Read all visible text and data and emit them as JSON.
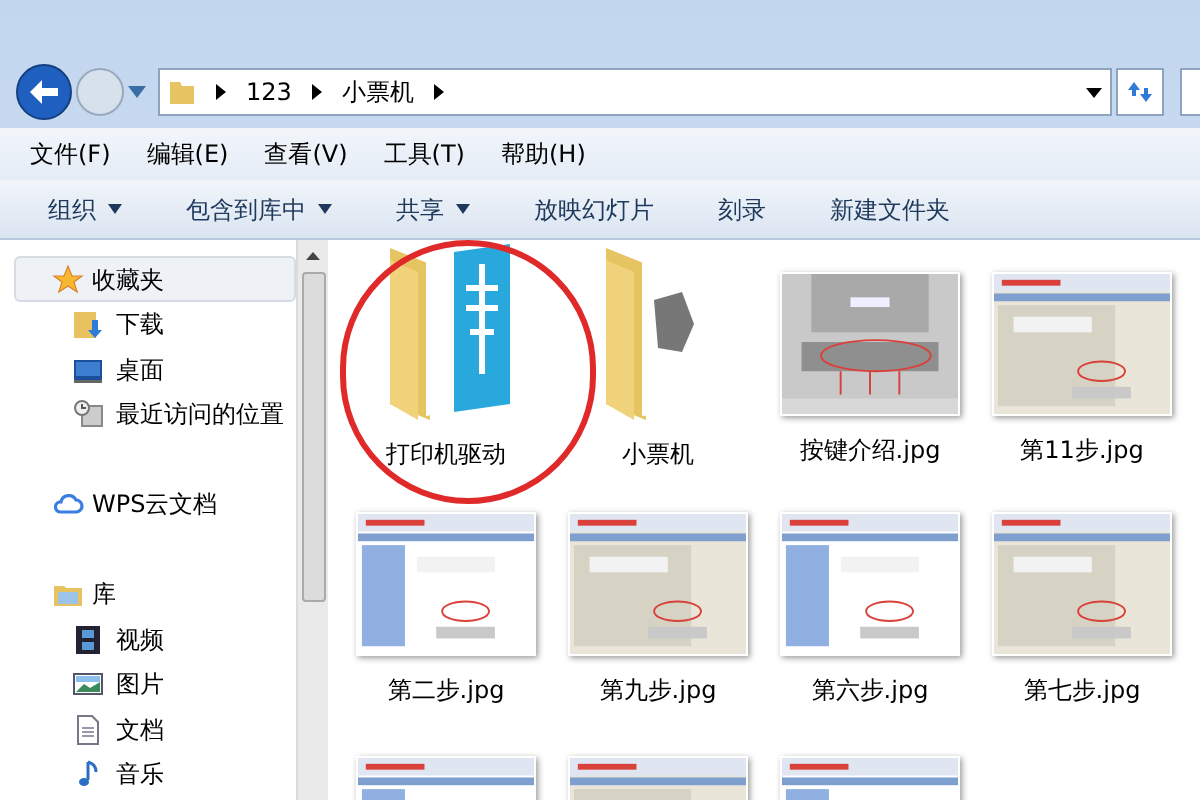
{
  "address_bar": {
    "path": [
      "123",
      "小票机"
    ]
  },
  "menu": [
    "文件(F)",
    "编辑(E)",
    "查看(V)",
    "工具(T)",
    "帮助(H)"
  ],
  "toolbar": [
    {
      "label": "组织",
      "dropdown": true
    },
    {
      "label": "包含到库中",
      "dropdown": true
    },
    {
      "label": "共享",
      "dropdown": true
    },
    {
      "label": "放映幻灯片",
      "dropdown": false
    },
    {
      "label": "刻录",
      "dropdown": false
    },
    {
      "label": "新建文件夹",
      "dropdown": false
    }
  ],
  "sidebar": {
    "sections": [
      {
        "label": "收藏夹",
        "selected": true,
        "children": [
          {
            "label": "下载"
          },
          {
            "label": "桌面"
          },
          {
            "label": "最近访问的位置"
          }
        ]
      },
      {
        "label": "WPS云文档",
        "selected": false
      },
      {
        "label": "库",
        "selected": false,
        "children": [
          {
            "label": "视频"
          },
          {
            "label": "图片"
          },
          {
            "label": "文档"
          },
          {
            "label": "音乐"
          }
        ]
      }
    ]
  },
  "files": [
    {
      "name": "打印机驱动",
      "kind": "folder",
      "circled": true
    },
    {
      "name": "小票机",
      "kind": "folder",
      "circled": false
    },
    {
      "name": "按键介绍.jpg",
      "kind": "picture",
      "circled": false
    },
    {
      "name": "第11步.jpg",
      "kind": "picture",
      "circled": false
    },
    {
      "name": "第二步.jpg",
      "kind": "picture",
      "circled": false
    },
    {
      "name": "第九步.jpg",
      "kind": "picture",
      "circled": false
    },
    {
      "name": "第六步.jpg",
      "kind": "picture",
      "circled": false
    },
    {
      "name": "第七步.jpg",
      "kind": "picture",
      "circled": false
    },
    {
      "kind": "picture",
      "circled": false
    },
    {
      "kind": "picture",
      "circled": false
    },
    {
      "kind": "picture",
      "circled": false
    }
  ]
}
